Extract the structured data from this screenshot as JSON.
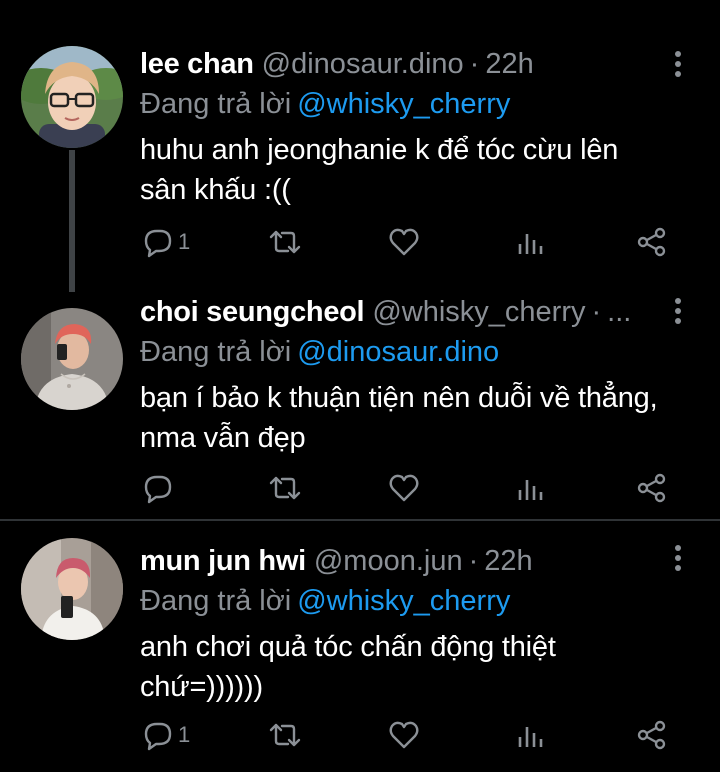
{
  "colors": {
    "background": "#000000",
    "text": "#ffffff",
    "muted": "#8b9096",
    "link": "#1d9bf0",
    "divider": "#2f3336"
  },
  "tweets": [
    {
      "display_name": "lee chan",
      "handle": "@dinosaur.dino",
      "separator": "·",
      "time": "22h",
      "reply_prefix": "Đang trả lời",
      "reply_to": "@whisky_cherry",
      "body_line1": "huhu anh jeonghanie k để tóc cừu lên",
      "body_line2": "sân khấu :((",
      "reply_count": "1",
      "avatar_icon": "avatar-photo"
    },
    {
      "display_name": "choi seungcheol",
      "handle": "@whisky_cherry",
      "separator": "·",
      "time": "...",
      "reply_prefix": "Đang trả lời",
      "reply_to": "@dinosaur.dino",
      "body_line1": "bạn í bảo k thuận tiện nên duỗi về thẳng,",
      "body_line2": "nma vẫn đẹp",
      "reply_count": "",
      "avatar_icon": "avatar-photo"
    },
    {
      "display_name": "mun jun hwi",
      "handle": "@moon.jun",
      "separator": "·",
      "time": "22h",
      "reply_prefix": "Đang trả lời",
      "reply_to": "@whisky_cherry",
      "body_line1": "anh chơi quả tóc chấn động thiệt",
      "body_line2": "chứ=))))))",
      "reply_count": "1",
      "avatar_icon": "avatar-photo"
    }
  ],
  "action_icons": [
    "reply-icon",
    "retweet-icon",
    "like-icon",
    "views-icon",
    "share-icon"
  ]
}
